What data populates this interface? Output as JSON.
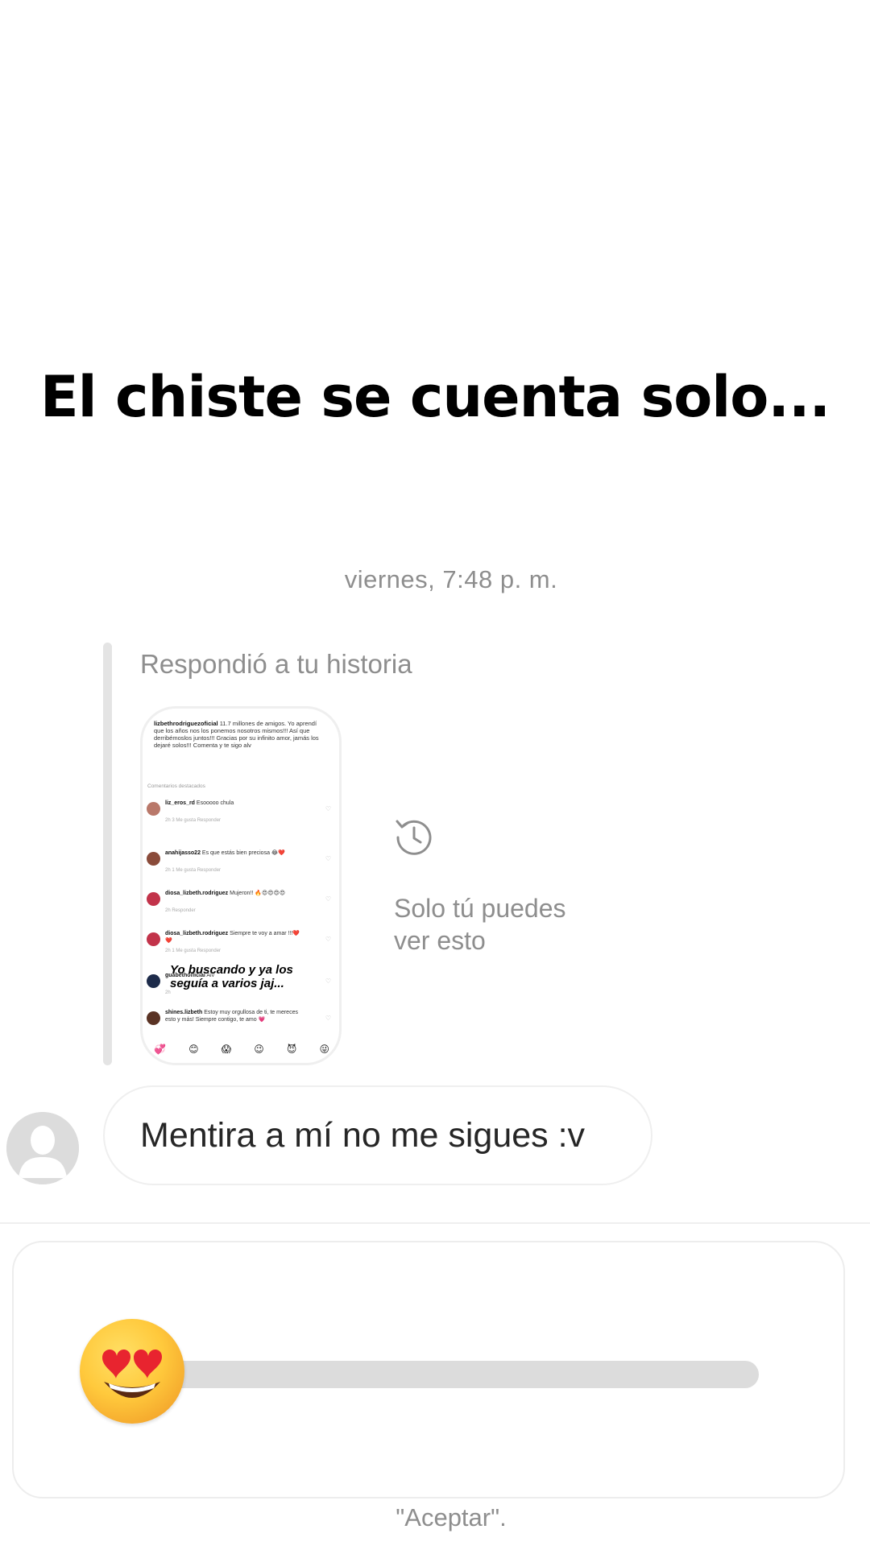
{
  "headline": "El chiste se cuenta solo...",
  "thread": {
    "timestamp": "viernes, 7:48 p. m.",
    "reply_label": "Respondió a tu historia",
    "only_you_line1": "Solo tú puedes",
    "only_you_line2": "ver esto",
    "message": "Mentira a mí no me sigues :v"
  },
  "story_thumbnail": {
    "caption_user": "lizbethrodriguezoficial",
    "caption_text": "11.7 millones de amigos. Yo aprendí que los años nos los ponemos nosotros mismos!!! Así que derribémoslos juntos!!! Gracias por su infinito amor, jamás los dejaré solos!!! Comenta y te sigo alv",
    "featured_label": "Comentarios destacados",
    "comments": [
      {
        "user": "liz_eros_rd",
        "text": "Esooooo chula",
        "meta": "2h   3 Me gusta   Responder",
        "color": "#b9786a"
      },
      {
        "user": "anahijasso22",
        "text": "Es que estás bien preciosa 😂❤️",
        "meta": "2h   1 Me gusta   Responder",
        "color": "#8a4b3a"
      },
      {
        "user": "diosa_lizbeth.rodriguez",
        "text": "Mujeron!! 🔥😍😍😍😍",
        "meta": "2h   Responder",
        "color": "#c2334a"
      },
      {
        "user": "diosa_lizbeth.rodriguez",
        "text": "Siempre te voy a amar !!!❤️❤️",
        "meta": "2h   1 Me gusta   Responder",
        "color": "#c2334a"
      },
      {
        "user": "guabethofficial",
        "text": "Alv",
        "meta": "2h",
        "color": "#1d2b4a"
      },
      {
        "user": "shines.lizbeth",
        "text": "Estoy muy orgullosa de ti, te mereces esto y más! Siempre contigo, te amo 💗",
        "meta": "",
        "color": "#5a3324"
      }
    ],
    "overlay_line1": "Yo buscando y ya los",
    "overlay_line2": "seguía a varios jaj...",
    "emoji_row": [
      "💞",
      "😊",
      "😱",
      "😉",
      "😈",
      "😜"
    ]
  },
  "composer": {
    "slider_emoji": "heart-eyes-emoji",
    "slider_value": 0
  },
  "hint_text": "\"Aceptar\"."
}
